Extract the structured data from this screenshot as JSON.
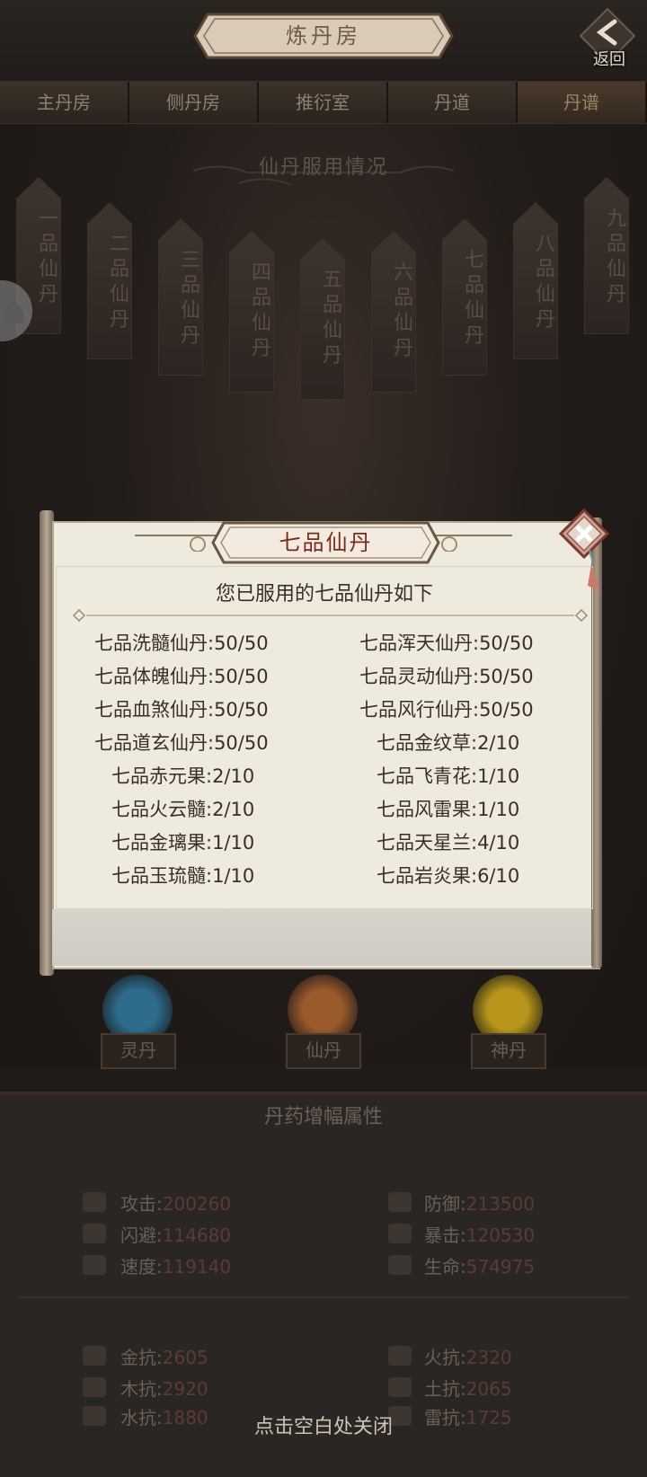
{
  "header": {
    "title": "炼丹房",
    "back_label": "返回"
  },
  "tabs": [
    {
      "label": "主丹房"
    },
    {
      "label": "侧丹房"
    },
    {
      "label": "推衍室"
    },
    {
      "label": "丹道"
    },
    {
      "label": "丹谱",
      "active": true
    }
  ],
  "section": {
    "title": "仙丹服用情况"
  },
  "banners": [
    {
      "label": "一品仙丹"
    },
    {
      "label": "二品仙丹"
    },
    {
      "label": "三品仙丹"
    },
    {
      "label": "四品仙丹"
    },
    {
      "label": "五品仙丹"
    },
    {
      "label": "六品仙丹"
    },
    {
      "label": "七品仙丹"
    },
    {
      "label": "八品仙丹"
    },
    {
      "label": "九品仙丹"
    }
  ],
  "dan_buttons": [
    {
      "label": "灵丹",
      "color": "#2f6c8c"
    },
    {
      "label": "仙丹",
      "color": "#9a5a2c"
    },
    {
      "label": "神丹",
      "color": "#b8961c"
    }
  ],
  "stats": {
    "title": "丹药增幅属性",
    "attack": {
      "label": "攻击:",
      "value": "200260"
    },
    "defense": {
      "label": "防御:",
      "value": "213500"
    },
    "dodge": {
      "label": "闪避:",
      "value": "114680"
    },
    "crit": {
      "label": "暴击:",
      "value": "120530"
    },
    "speed": {
      "label": "速度:",
      "value": "119140"
    },
    "life": {
      "label": "生命:",
      "value": "574975"
    },
    "metal_res": {
      "label": "金抗:",
      "value": "2605"
    },
    "fire_res": {
      "label": "火抗:",
      "value": "2320"
    },
    "wood_res": {
      "label": "木抗:",
      "value": "2920"
    },
    "earth_res": {
      "label": "土抗:",
      "value": "2065"
    },
    "water_res": {
      "label": "水抗:",
      "value": "1880"
    },
    "thunder_res": {
      "label": "雷抗:",
      "value": "1725"
    }
  },
  "close_hint": "点击空白处关闭",
  "modal": {
    "title": "七品仙丹",
    "subtitle": "您已服用的七品仙丹如下",
    "items_left": [
      "七品洗髓仙丹:50/50",
      "七品体魄仙丹:50/50",
      "七品血煞仙丹:50/50",
      "七品道玄仙丹:50/50",
      "七品赤元果:2/10",
      "七品火云髓:2/10",
      "七品金璃果:1/10",
      "七品玉琉髓:1/10"
    ],
    "items_right": [
      "七品浑天仙丹:50/50",
      "七品灵动仙丹:50/50",
      "七品风行仙丹:50/50",
      "七品金纹草:2/10",
      "七品飞青花:1/10",
      "七品风雷果:1/10",
      "七品天星兰:4/10",
      "七品岩炎果:6/10"
    ]
  },
  "colors": {
    "accent": "#7a2a1a",
    "paper": "#efeade",
    "stat_value": "#5f3a35"
  }
}
